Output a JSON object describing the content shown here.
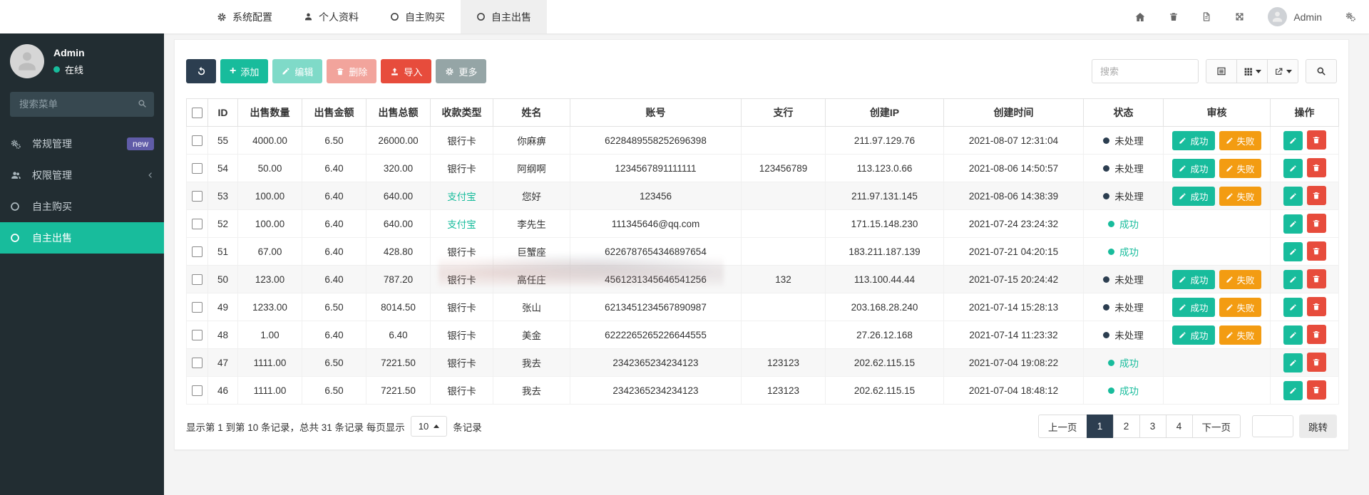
{
  "navbar": {
    "tabs": [
      {
        "label": "系统配置",
        "icon": "gear-icon"
      },
      {
        "label": "个人资料",
        "icon": "user-icon"
      },
      {
        "label": "自主购买",
        "icon": "circle-icon"
      },
      {
        "label": "自主出售",
        "icon": "circle-icon",
        "active": true
      }
    ],
    "user_name": "Admin"
  },
  "sidebar": {
    "user_name": "Admin",
    "user_status": "在线",
    "search_placeholder": "搜索菜单",
    "items": [
      {
        "label": "常规管理",
        "icon": "cogs-icon",
        "badge": "new"
      },
      {
        "label": "权限管理",
        "icon": "users-icon",
        "chevron": true
      },
      {
        "label": "自主购买",
        "icon": "circle-icon"
      },
      {
        "label": "自主出售",
        "icon": "circle-icon",
        "active": true
      }
    ]
  },
  "toolbar": {
    "add_label": "添加",
    "edit_label": "编辑",
    "delete_label": "删除",
    "import_label": "导入",
    "more_label": "更多",
    "search_placeholder": "搜索"
  },
  "table": {
    "columns": [
      "ID",
      "出售数量",
      "出售金额",
      "出售总额",
      "收款类型",
      "姓名",
      "账号",
      "支行",
      "创建IP",
      "创建时间",
      "状态",
      "审核",
      "操作"
    ],
    "status_pending": "未处理",
    "status_success": "成功",
    "audit_success": "成功",
    "audit_fail": "失败",
    "rows": [
      {
        "id": "55",
        "qty": "4000.00",
        "price": "6.50",
        "total": "26000.00",
        "pay_type": "银行卡",
        "pay_alipay": false,
        "name": "你麻痹",
        "account": "6228489558252696398",
        "branch": "",
        "ip": "211.97.129.76",
        "created": "2021-08-07 12:31:04",
        "status": "pending"
      },
      {
        "id": "54",
        "qty": "50.00",
        "price": "6.40",
        "total": "320.00",
        "pay_type": "银行卡",
        "pay_alipay": false,
        "name": "阿纲啊",
        "account": "1234567891111111",
        "branch": "123456789",
        "ip": "113.123.0.66",
        "created": "2021-08-06 14:50:57",
        "status": "pending"
      },
      {
        "id": "53",
        "qty": "100.00",
        "price": "6.40",
        "total": "640.00",
        "pay_type": "支付宝",
        "pay_alipay": true,
        "name": "您好",
        "account": "123456",
        "branch": "",
        "ip": "211.97.131.145",
        "created": "2021-08-06 14:38:39",
        "status": "pending"
      },
      {
        "id": "52",
        "qty": "100.00",
        "price": "6.40",
        "total": "640.00",
        "pay_type": "支付宝",
        "pay_alipay": true,
        "name": "李先生",
        "account": "111345646@qq.com",
        "branch": "",
        "ip": "171.15.148.230",
        "created": "2021-07-24 23:24:32",
        "status": "success"
      },
      {
        "id": "51",
        "qty": "67.00",
        "price": "6.40",
        "total": "428.80",
        "pay_type": "银行卡",
        "pay_alipay": false,
        "name": "巨蟹座",
        "account": "6226787654346897654",
        "branch": "",
        "ip": "183.211.187.139",
        "created": "2021-07-21 04:20:15",
        "status": "success"
      },
      {
        "id": "50",
        "qty": "123.00",
        "price": "6.40",
        "total": "787.20",
        "pay_type": "银行卡",
        "pay_alipay": false,
        "name": "高任庄",
        "account": "4561231345646541256",
        "branch": "132",
        "ip": "113.100.44.44",
        "created": "2021-07-15 20:24:42",
        "status": "pending"
      },
      {
        "id": "49",
        "qty": "1233.00",
        "price": "6.50",
        "total": "8014.50",
        "pay_type": "银行卡",
        "pay_alipay": false,
        "name": "张山",
        "account": "6213451234567890987",
        "branch": "",
        "ip": "203.168.28.240",
        "created": "2021-07-14 15:28:13",
        "status": "pending"
      },
      {
        "id": "48",
        "qty": "1.00",
        "price": "6.40",
        "total": "6.40",
        "pay_type": "银行卡",
        "pay_alipay": false,
        "name": "美金",
        "account": "6222265265226644555",
        "branch": "",
        "ip": "27.26.12.168",
        "created": "2021-07-14 11:23:32",
        "status": "pending"
      },
      {
        "id": "47",
        "qty": "1111.00",
        "price": "6.50",
        "total": "7221.50",
        "pay_type": "银行卡",
        "pay_alipay": false,
        "name": "我去",
        "account": "2342365234234123",
        "branch": "123123",
        "ip": "202.62.115.15",
        "created": "2021-07-04 19:08:22",
        "status": "success"
      },
      {
        "id": "46",
        "qty": "1111.00",
        "price": "6.50",
        "total": "7221.50",
        "pay_type": "银行卡",
        "pay_alipay": false,
        "name": "我去",
        "account": "2342365234234123",
        "branch": "123123",
        "ip": "202.62.115.15",
        "created": "2021-07-04 18:48:12",
        "status": "success"
      }
    ]
  },
  "pagination": {
    "summary_prefix": "显示第 1 到第 10 条记录，总共 31 条记录 每页显示",
    "page_size": "10",
    "summary_suffix": "条记录",
    "prev_label": "上一页",
    "next_label": "下一页",
    "pages": [
      "1",
      "2",
      "3",
      "4"
    ],
    "active_page": "1",
    "jump_label": "跳转"
  },
  "colors": {
    "accent": "#18bc9c",
    "danger": "#e74c3c",
    "warning": "#f39c12",
    "navy": "#2c3e50",
    "gray": "#95a5a6",
    "badge_purple": "#605ca8",
    "sidebar_bg": "#222d32"
  }
}
